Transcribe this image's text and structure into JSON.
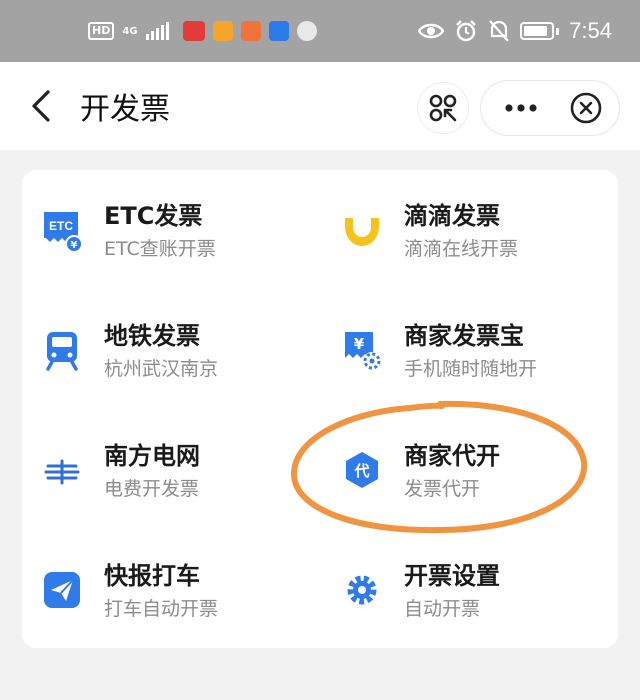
{
  "status_bar": {
    "badges": [
      "HD",
      "4G"
    ],
    "time": "7:54",
    "icons": [
      "eye-icon",
      "alarm-icon",
      "mute-icon",
      "battery-icon"
    ]
  },
  "nav": {
    "title": "开发票",
    "icons": [
      "back-icon",
      "scan-icon",
      "more-icon",
      "close-icon"
    ]
  },
  "items": [
    {
      "title": "ETC发票",
      "subtitle": "ETC查账开票",
      "icon": "etc-icon",
      "icon_label": "ETC",
      "color": "#2f7be9"
    },
    {
      "title": "滴滴发票",
      "subtitle": "滴滴在线开票",
      "icon": "didi-icon",
      "color": "#f7c21c"
    },
    {
      "title": "地铁发票",
      "subtitle": "杭州武汉南京",
      "icon": "metro-icon",
      "color": "#2f7be9"
    },
    {
      "title": "商家发票宝",
      "subtitle": "手机随时随地开",
      "icon": "merchant-invoice-icon",
      "color": "#2f7be9"
    },
    {
      "title": "南方电网",
      "subtitle": "电费开发票",
      "icon": "power-grid-icon",
      "color": "#2f6fd6"
    },
    {
      "title": "商家代开",
      "subtitle": "发票代开",
      "icon": "proxy-invoice-icon",
      "icon_label": "代",
      "color": "#2f7be9"
    },
    {
      "title": "快报打车",
      "subtitle": "打车自动开票",
      "icon": "taxi-icon",
      "color": "#2f7be9"
    },
    {
      "title": "开票设置",
      "subtitle": "自动开票",
      "icon": "settings-gear-icon",
      "color": "#2f7be9"
    }
  ],
  "annotation": {
    "color": "#f0943f"
  }
}
